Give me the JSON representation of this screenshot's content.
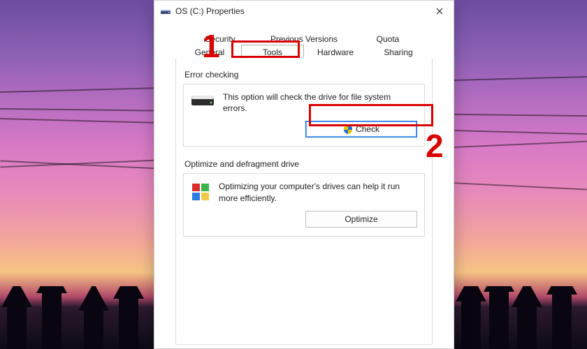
{
  "window": {
    "title": "OS (C:) Properties"
  },
  "tabs_row1": [
    "Security",
    "Previous Versions",
    "Quota"
  ],
  "tabs_row2": [
    "General",
    "Tools",
    "Hardware",
    "Sharing"
  ],
  "active_tab": "Tools",
  "sections": {
    "error_checking": {
      "title": "Error checking",
      "description": "This option will check the drive for file system errors.",
      "button": "Check"
    },
    "optimize": {
      "title": "Optimize and defragment drive",
      "description": "Optimizing your computer's drives can help it run more efficiently.",
      "button": "Optimize"
    }
  },
  "annotations": {
    "step1": "1",
    "step2": "2"
  }
}
